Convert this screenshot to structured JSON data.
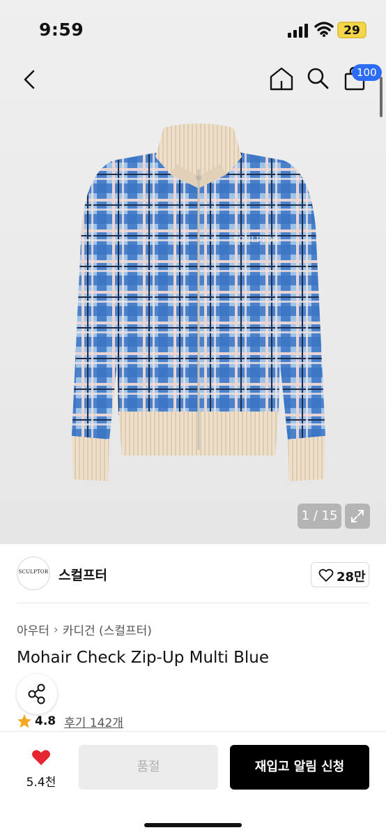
{
  "status_bar": {
    "time": "9:59",
    "battery": "29",
    "icons": [
      "signal-icon",
      "wifi-icon",
      "battery-icon"
    ]
  },
  "header": {
    "icons": [
      "back-icon",
      "home-icon",
      "search-icon",
      "shopping-bag-icon"
    ],
    "cart_badge": "100"
  },
  "gallery": {
    "counter": "1 / 15",
    "chest_logo": "SCULPTOR",
    "expand_icon": "expand-icon"
  },
  "brand": {
    "logo_text": "SCULPTOR",
    "name": "스컬프터",
    "like_count": "28만"
  },
  "product": {
    "breadcrumb": [
      "아우터",
      "카디건 (스컬프터)"
    ],
    "title": "Mohair Check Zip-Up Multi Blue",
    "rating": "4.8",
    "review_label": "후기 142개"
  },
  "actions": {
    "wish_count": "5.4천",
    "soldout_label": "품절",
    "restock_label": "재입고 알림 신청"
  },
  "colors": {
    "accent_badge": "#2d6cf4",
    "heart": "#e3262f",
    "star": "#f5a623",
    "primary_button": "#000000"
  }
}
